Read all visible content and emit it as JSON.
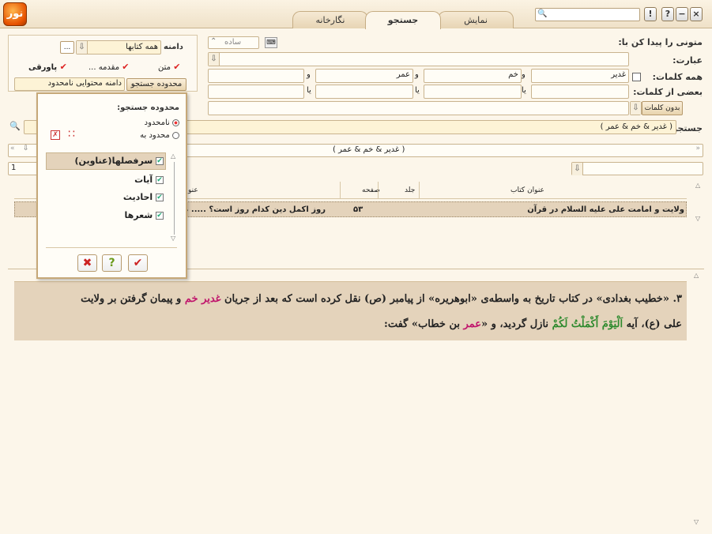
{
  "window": {
    "logo_text": "نور",
    "tabs": [
      "نگارخانه",
      "جستجو",
      "نمایش"
    ],
    "active_tab": "جستجو",
    "buttons": [
      "!",
      "?",
      "−",
      "×"
    ]
  },
  "search_form": {
    "title_label": "متونی را پیدا کن با:",
    "mode_label": "ساده",
    "phrase_label": "عبارت:",
    "all_words_label": "همه کلمات:",
    "all_words": [
      "غدیر",
      "خم",
      "عمر",
      ""
    ],
    "and_word": "و",
    "some_words_label": "بعضی از کلمات:",
    "or_word": "یا",
    "without_words_button": "بدون کلمات",
    "query_label": "جستجوی:",
    "query_value": "( غدیر & خم  & عمر )"
  },
  "left_panel": {
    "scope_label": "دامنه",
    "scope_value": "همه کتابها",
    "more_button": "...",
    "check_text": "متن",
    "check_intro": "مقدمه ...",
    "check_footnote": "پاورقی",
    "search_scope_button": "محدوده جستجو",
    "content_scope_value": "دامنه محتوایی نامحدود"
  },
  "popup": {
    "title": "محدوده جستجو:",
    "option_unlimited": "نامحدود",
    "option_limited": "محدود به",
    "items": [
      "سرفصلها(عناوین)",
      "آیات",
      "احادیث",
      "شعرها"
    ]
  },
  "results": {
    "query_display": "( غدیر & خم  & عمر )",
    "page_number": "1",
    "columns": {
      "title": "عنوان کتاب",
      "volume": "جلد",
      "page": "صفحه",
      "heading": "عنو"
    },
    "row": {
      "book_title": "ولایت و امامت علی علیه السلام در قرآن",
      "volume": "",
      "page": "۵۳",
      "heading": "روز اکمل دین کدام روز است؟ ..... ص"
    }
  },
  "text_view": {
    "line1_part1": "۳. «خطیب بغدادی» در کتاب تاریخ به واسطه‌ی «ابوهریره» از پیامبر (ص) نقل کرده است که بعد از جریان ",
    "line1_highlight": "غدیر خم",
    "line1_part2": " و پیمان گرفتن بر ولایت",
    "line2_part1": "علی (ع)، آیه ",
    "line2_verse": "اَلْيَوْمَ أَكْمَلْتُ لَكُمْ",
    "line2_part2": " نازل گردید، و «",
    "line2_highlight": "عمر",
    "line2_part3": " بن خطاب» گفت:"
  }
}
